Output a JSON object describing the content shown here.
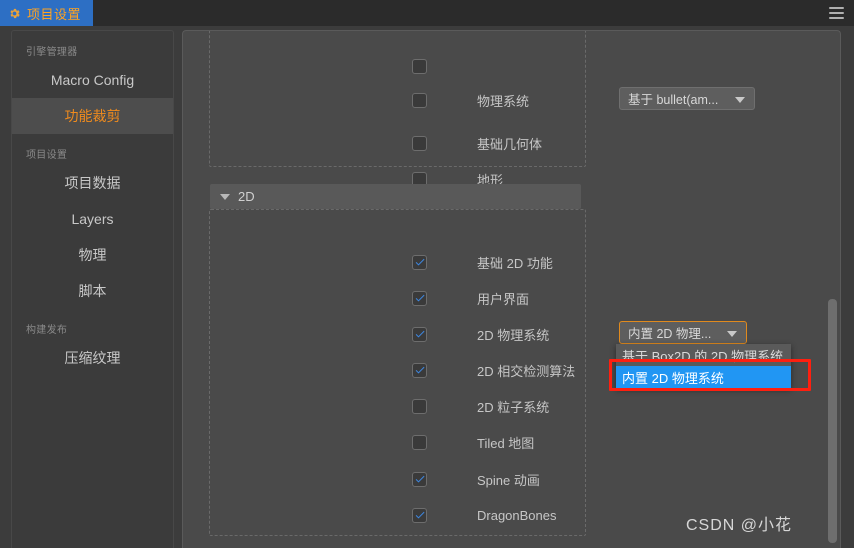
{
  "titlebar": {
    "tab_label": "项目设置",
    "gear_icon": "gear-icon",
    "menu_icon": "hamburger-menu-icon"
  },
  "sidebar": {
    "groups": [
      {
        "title": "引擎管理器",
        "items": [
          {
            "label": "Macro Config",
            "active": false
          },
          {
            "label": "功能裁剪",
            "active": true
          }
        ]
      },
      {
        "title": "项目设置",
        "items": [
          {
            "label": "项目数据",
            "active": false
          },
          {
            "label": "Layers",
            "active": false
          },
          {
            "label": "物理",
            "active": false
          },
          {
            "label": "脚本",
            "active": false
          }
        ]
      },
      {
        "title": "构建发布",
        "items": [
          {
            "label": "压缩纹理",
            "active": false
          }
        ]
      }
    ]
  },
  "main": {
    "group_3d": {
      "rows": [
        {
          "label": "物理系统",
          "checked": false,
          "select": {
            "value": "基于 bullet(am...",
            "caret": "chevron-down-icon"
          }
        },
        {
          "label": "基础几何体",
          "checked": false
        },
        {
          "label": "地形",
          "checked": false
        }
      ]
    },
    "group_2d": {
      "title": "2D",
      "caret": "caret-down-icon",
      "rows": [
        {
          "label": "基础 2D 功能",
          "checked": true
        },
        {
          "label": "用户界面",
          "checked": true
        },
        {
          "label": "2D 物理系统",
          "checked": true,
          "select": {
            "value": "内置 2D 物理...",
            "caret": "chevron-down-icon",
            "focused": true
          }
        },
        {
          "label": "2D 相交检测算法",
          "checked": true
        },
        {
          "label": "2D 粒子系统",
          "checked": false
        },
        {
          "label": "Tiled 地图",
          "checked": false
        },
        {
          "label": "Spine 动画",
          "checked": true
        },
        {
          "label": "DragonBones",
          "checked": true
        }
      ]
    },
    "dropdown": {
      "options": [
        {
          "label": "基于 Box2D 的 2D 物理系统",
          "selected": false
        },
        {
          "label": "内置 2D 物理系统",
          "selected": true
        }
      ]
    }
  },
  "watermark": "CSDN @小花",
  "colors": {
    "accent_orange": "#f08b1d",
    "tab_blue": "#2d6fc4",
    "highlight_blue": "#2196f3",
    "annotation_red": "#ff1f0f",
    "checkbox_blue": "#3d86e0"
  }
}
